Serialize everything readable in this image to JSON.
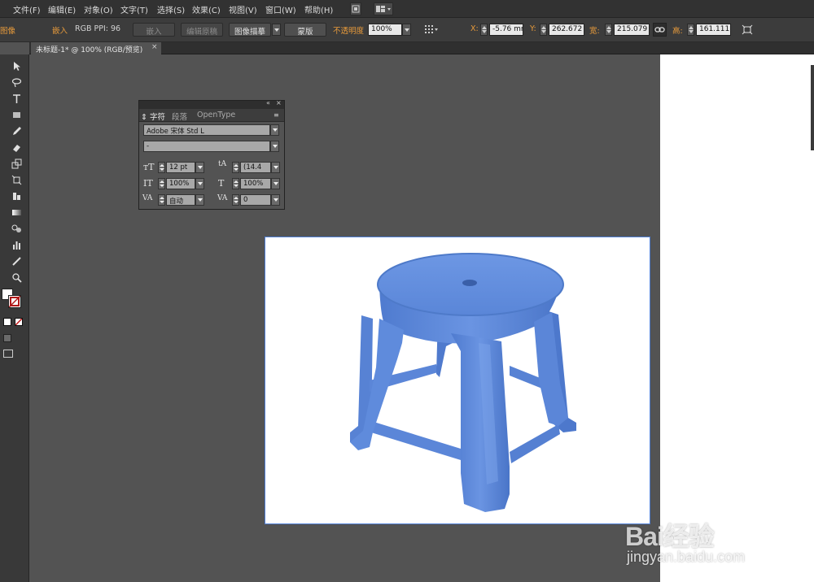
{
  "menubar": {
    "items": [
      "文件(F)",
      "编辑(E)",
      "对象(O)",
      "文字(T)",
      "选择(S)",
      "效果(C)",
      "视图(V)",
      "窗口(W)",
      "帮助(H)"
    ]
  },
  "control_bar": {
    "left_label": "图像",
    "embedded_label": "嵌入",
    "color_info": "RGB  PPI: 96",
    "embed_button": "嵌入",
    "edit_original_button": "编辑原稿",
    "image_trace_button": "图像描摹",
    "mask_button": "蒙版",
    "opacity_label": "不透明度",
    "opacity_value": "100%",
    "x_label": "X:",
    "x_value": "-5.76 mm",
    "y_label": "Y:",
    "y_value": "262.672 m",
    "w_label": "宽:",
    "w_value": "215.079 m",
    "h_label": "高:",
    "h_value": "161.111 m"
  },
  "document_tab": {
    "title": "未标题-1* @ 100% (RGB/预览)",
    "close": "×"
  },
  "character_panel": {
    "tabs": [
      "字符",
      "段落",
      "OpenType"
    ],
    "active_tab": "字符",
    "font_family": "Adobe 宋体 Std L",
    "font_style": "-",
    "font_size": "12 pt",
    "leading": "(14.4",
    "vertical_scale": "100%",
    "horizontal_scale": "100%",
    "kerning": "自动",
    "tracking": "0"
  },
  "canvas": {
    "placed_image_subject": "blue plastic stool",
    "stool_color": "#5b87dc",
    "artboard_color": "#ffffff",
    "pasteboard_color": "#535353"
  },
  "watermark": {
    "brand": "Bai经验",
    "url": "jingyan.baidu.com"
  },
  "colors": {
    "accent_orange": "#e89b3b",
    "selection_blue": "#4f7fd6"
  }
}
